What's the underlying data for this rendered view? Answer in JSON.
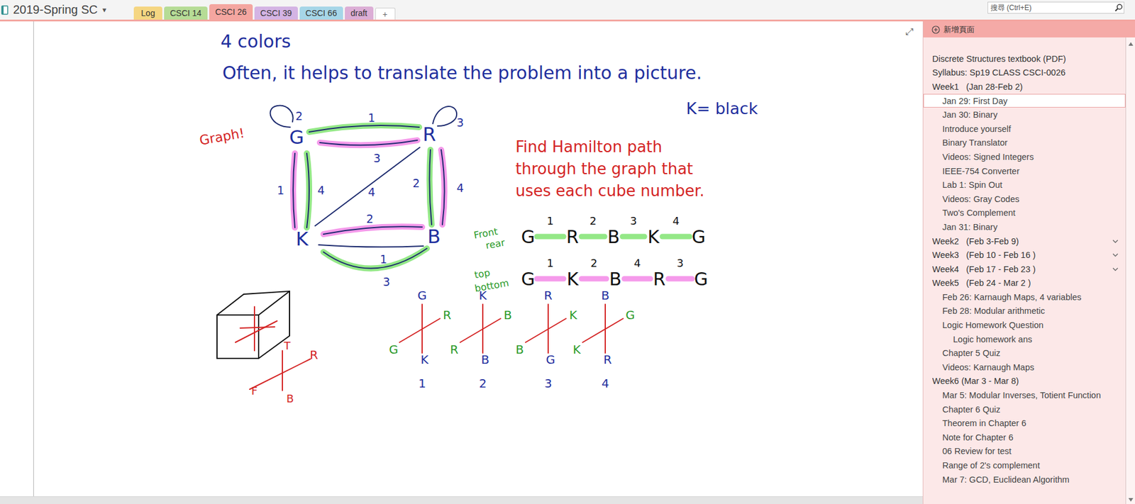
{
  "notebook": {
    "title": "2019-Spring SC",
    "dropdown": "▾"
  },
  "section_tabs": [
    {
      "label": "Log",
      "selected": false,
      "color": "#f5d682"
    },
    {
      "label": "CSCI 14",
      "selected": false,
      "color": "#b6dc96"
    },
    {
      "label": "CSCI 26",
      "selected": true,
      "color": "#f4a6a0"
    },
    {
      "label": "CSCI 39",
      "selected": false,
      "color": "#d4b4e4"
    },
    {
      "label": "CSCI 66",
      "selected": false,
      "color": "#a6d6e8"
    },
    {
      "label": "draft",
      "selected": false,
      "color": "#dcaed6"
    }
  ],
  "add_tab": "+",
  "search": {
    "placeholder": "搜尋 (Ctrl+E)"
  },
  "note": {
    "expand": "⤢",
    "heading": "4 colors",
    "intro": "Often, it helps to translate the problem into a picture.",
    "graph_label": "Graph!",
    "legend": "K= black",
    "task": [
      "Find Hamilton path",
      "through the graph that",
      "uses each cube number."
    ],
    "graph": {
      "nodes": [
        {
          "label": "G"
        },
        {
          "label": "R"
        },
        {
          "label": "K"
        },
        {
          "label": "B"
        }
      ],
      "edges": [
        {
          "from": "G",
          "to": "R",
          "label": "1",
          "kind": "green"
        },
        {
          "from": "G",
          "to": "R",
          "label": "3",
          "kind": "pink"
        },
        {
          "from": "G",
          "to": "G",
          "label": "2",
          "kind": "plain"
        },
        {
          "from": "R",
          "to": "R",
          "label": "3",
          "kind": "plain"
        },
        {
          "from": "G",
          "to": "K",
          "label": "1",
          "kind": "pink"
        },
        {
          "from": "G",
          "to": "K",
          "label": "4",
          "kind": "green"
        },
        {
          "from": "R",
          "to": "B",
          "label": "2",
          "kind": "green"
        },
        {
          "from": "R",
          "to": "B",
          "label": "4",
          "kind": "pink"
        },
        {
          "from": "K",
          "to": "R",
          "label": "4",
          "kind": "plain"
        },
        {
          "from": "K",
          "to": "B",
          "label": "2",
          "kind": "pink"
        },
        {
          "from": "K",
          "to": "B",
          "label": "1",
          "kind": "plain"
        },
        {
          "from": "K",
          "to": "B",
          "label": "3",
          "kind": "green"
        }
      ]
    },
    "paths": [
      {
        "label": [
          "Front",
          "rear"
        ],
        "kind": "green",
        "nodes": [
          "G",
          "R",
          "B",
          "K",
          "G"
        ],
        "numbers": [
          "1",
          "2",
          "3",
          "4"
        ]
      },
      {
        "label": [
          "top",
          "bottom"
        ],
        "kind": "pink",
        "nodes": [
          "G",
          "K",
          "B",
          "R",
          "G"
        ],
        "numbers": [
          "1",
          "2",
          "4",
          "3"
        ]
      }
    ],
    "cube_axes": {
      "top": "T",
      "right": "R",
      "front": "F",
      "bottom": "B"
    },
    "cubes": [
      {
        "top": "G",
        "right": "R",
        "left": "G",
        "bottom": "K",
        "number": "1"
      },
      {
        "top": "K",
        "right": "B",
        "left": "R",
        "bottom": "B",
        "number": "2"
      },
      {
        "top": "R",
        "right": "K",
        "left": "B",
        "bottom": "G",
        "number": "3"
      },
      {
        "top": "B",
        "right": "G",
        "left": "K",
        "bottom": "R",
        "number": "4"
      }
    ]
  },
  "pages": {
    "new_page": "新增頁面",
    "items": [
      {
        "label": "Discrete Structures textbook (PDF)",
        "kind": "section",
        "selected": false,
        "collapsed": false
      },
      {
        "label": "Syllabus: Sp19 CLASS CSCI-0026",
        "kind": "section",
        "selected": false,
        "collapsed": false
      },
      {
        "label": "Week1   (Jan 28-Feb 2)",
        "kind": "section",
        "selected": false,
        "collapsed": false
      },
      {
        "label": "Jan 29: First Day",
        "kind": "page",
        "selected": true,
        "collapsed": false
      },
      {
        "label": "Jan 30: Binary",
        "kind": "page",
        "selected": false,
        "collapsed": false
      },
      {
        "label": "Introduce yourself",
        "kind": "page",
        "selected": false,
        "collapsed": false
      },
      {
        "label": "Binary Translator",
        "kind": "page",
        "selected": false,
        "collapsed": false
      },
      {
        "label": "Videos: Signed Integers",
        "kind": "page",
        "selected": false,
        "collapsed": false
      },
      {
        "label": "IEEE-754 Converter",
        "kind": "page",
        "selected": false,
        "collapsed": false
      },
      {
        "label": "Lab 1: Spin Out",
        "kind": "page",
        "selected": false,
        "collapsed": false
      },
      {
        "label": "Videos: Gray Codes",
        "kind": "page",
        "selected": false,
        "collapsed": false
      },
      {
        "label": "Two's Complement",
        "kind": "page",
        "selected": false,
        "collapsed": false
      },
      {
        "label": "Jan 31: Binary",
        "kind": "page",
        "selected": false,
        "collapsed": false
      },
      {
        "label": "Week2   (Feb 3-Feb 9)",
        "kind": "section",
        "selected": false,
        "collapsed": true
      },
      {
        "label": "Week3   (Feb 10 - Feb 16 )",
        "kind": "section",
        "selected": false,
        "collapsed": true
      },
      {
        "label": "Week4   (Feb 17 - Feb 23 )",
        "kind": "section",
        "selected": false,
        "collapsed": true
      },
      {
        "label": "Week5   (Feb 24 - Mar 2 )",
        "kind": "section",
        "selected": false,
        "collapsed": false
      },
      {
        "label": "Feb 26: Karnaugh Maps, 4 variables",
        "kind": "page",
        "selected": false,
        "collapsed": false
      },
      {
        "label": "Feb 28: Modular arithmetic",
        "kind": "page",
        "selected": false,
        "collapsed": false
      },
      {
        "label": "Logic Homework Question",
        "kind": "page",
        "selected": false,
        "collapsed": false
      },
      {
        "label": "Logic homework ans",
        "kind": "subpage",
        "selected": false,
        "collapsed": false
      },
      {
        "label": "Chapter 5 Quiz",
        "kind": "page",
        "selected": false,
        "collapsed": false
      },
      {
        "label": "Videos: Karnaugh Maps",
        "kind": "page",
        "selected": false,
        "collapsed": false
      },
      {
        "label": "Week6 (Mar 3 - Mar 8)",
        "kind": "section",
        "selected": false,
        "collapsed": false
      },
      {
        "label": "Mar 5: Modular Inverses, Totient Function",
        "kind": "page",
        "selected": false,
        "collapsed": false
      },
      {
        "label": "Chapter 6 Quiz",
        "kind": "page",
        "selected": false,
        "collapsed": false
      },
      {
        "label": "Theorem in Chapter 6",
        "kind": "page",
        "selected": false,
        "collapsed": false
      },
      {
        "label": "Note for Chapter 6",
        "kind": "page",
        "selected": false,
        "collapsed": false
      },
      {
        "label": "06 Review for test",
        "kind": "page",
        "selected": false,
        "collapsed": false
      },
      {
        "label": "Range of 2's complement",
        "kind": "page",
        "selected": false,
        "collapsed": false
      },
      {
        "label": "Mar 7: GCD, Euclidean Algorithm",
        "kind": "page",
        "selected": false,
        "collapsed": false
      }
    ]
  }
}
